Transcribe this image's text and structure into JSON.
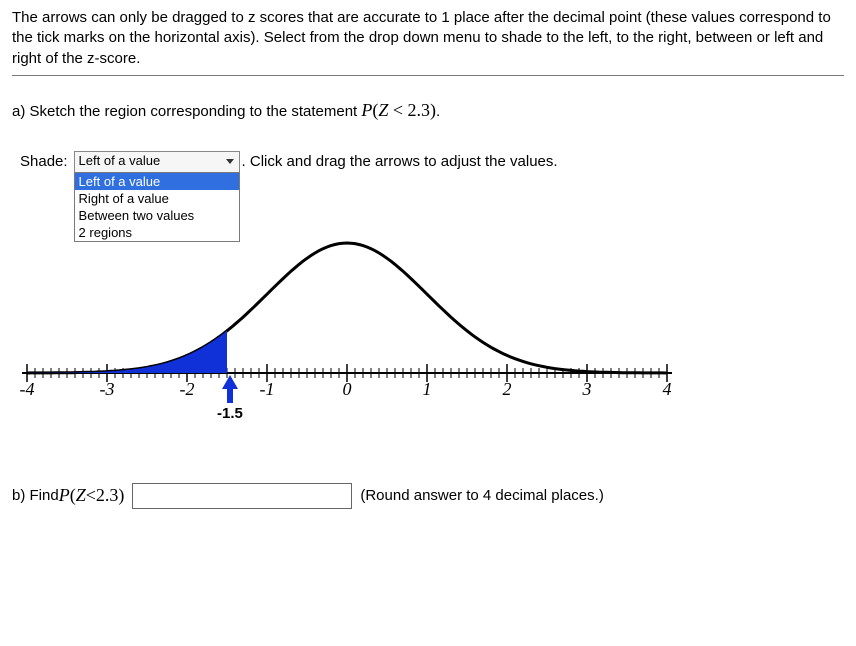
{
  "intro": "The arrows can only be dragged to z scores that are accurate to 1 place after the decimal point (these values correspond to the tick marks on the horizontal axis). Select from the drop down menu to shade to the left, to the right, between or left and right of the z-score.",
  "partA": {
    "prefix": "a) Sketch the region corresponding to the statement ",
    "formula_P": "P",
    "formula_paren_open": "(",
    "formula_Z": "Z",
    "formula_op": " < ",
    "formula_val": "2.3",
    "formula_paren_close": ")",
    "period": "."
  },
  "shade": {
    "label": "Shade:",
    "selected": "Left of a value",
    "after_period": ".",
    "after_text": " Click and drag the arrows to adjust the values.",
    "options": [
      "Left of a value",
      "Right of a value",
      "Between two values",
      "2 regions"
    ]
  },
  "chart_data": {
    "type": "line",
    "title": "",
    "xlabel": "",
    "ylabel": "",
    "xlim": [
      -4,
      4
    ],
    "tick_labels": [
      "-4",
      "-3",
      "-2",
      "-1",
      "0",
      "1",
      "2",
      "3",
      "4"
    ],
    "arrow_value": -1.5,
    "arrow_label": "-1.5",
    "shaded_region": "left_of_arrow",
    "curve": "standard_normal_pdf"
  },
  "partB": {
    "prefix": "b) Find ",
    "formula_P": "P",
    "formula_paren_open": "(",
    "formula_Z": "Z",
    "formula_op": " < ",
    "formula_val": "2.3",
    "formula_paren_close": ")",
    "answer_value": "",
    "hint": "(Round answer to 4 decimal places.)"
  }
}
